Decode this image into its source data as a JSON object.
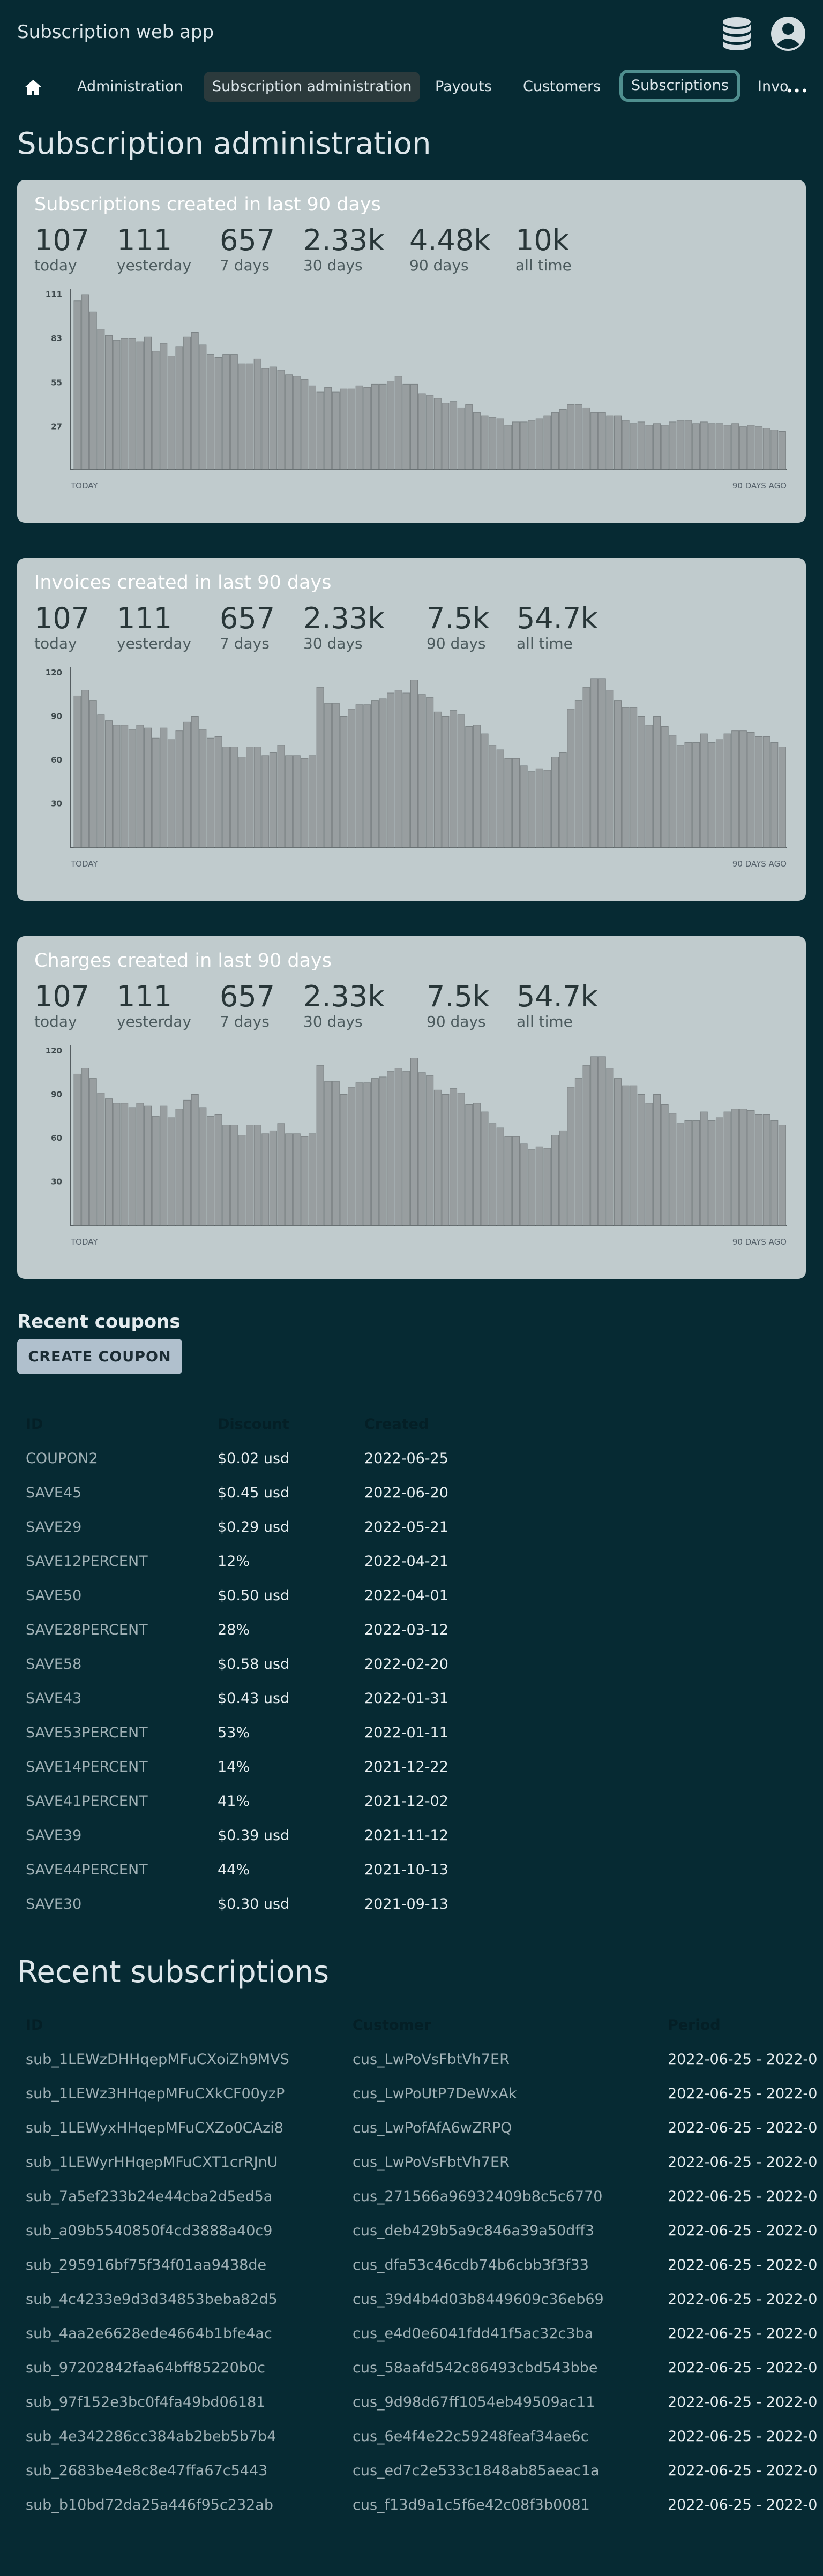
{
  "app": {
    "title": "Subscription web app",
    "icons": [
      "database-icon",
      "account-icon"
    ]
  },
  "nav": {
    "home_icon": "home-icon",
    "items": [
      {
        "label": "Administration"
      },
      {
        "label": "Subscription administration",
        "state": "selected"
      },
      {
        "label": "Payouts"
      },
      {
        "label": "Customers"
      },
      {
        "label": "Subscriptions",
        "state": "focused"
      },
      {
        "label": "Invo"
      }
    ],
    "more_label": "•••"
  },
  "page": {
    "title": "Subscription administration"
  },
  "cards": [
    {
      "title": "Subscriptions created in last 90 days",
      "stats": [
        {
          "value": "107",
          "label": "today"
        },
        {
          "value": "111",
          "label": "yesterday"
        },
        {
          "value": "657",
          "label": "7 days"
        },
        {
          "value": "2.33k",
          "label": "30 days"
        },
        {
          "value": "4.48k",
          "label": "90 days"
        },
        {
          "value": "10k",
          "label": "all time"
        }
      ]
    },
    {
      "title": "Invoices created in last 90 days",
      "stats": [
        {
          "value": "107",
          "label": "today"
        },
        {
          "value": "111",
          "label": "yesterday"
        },
        {
          "value": "657",
          "label": "7 days"
        },
        {
          "value": "2.33k",
          "label": "30 days"
        },
        {
          "value": "7.5k",
          "label": "90 days"
        },
        {
          "value": "54.7k",
          "label": "all time"
        }
      ]
    },
    {
      "title": "Charges created in last 90 days",
      "stats": [
        {
          "value": "107",
          "label": "today"
        },
        {
          "value": "111",
          "label": "yesterday"
        },
        {
          "value": "657",
          "label": "7 days"
        },
        {
          "value": "2.33k",
          "label": "30 days"
        },
        {
          "value": "7.5k",
          "label": "90 days"
        },
        {
          "value": "54.7k",
          "label": "all time"
        }
      ]
    }
  ],
  "chart_data": [
    {
      "type": "bar",
      "title": "Subscriptions created in last 90 days",
      "x_start_label": "TODAY",
      "x_end_label": "90 DAYS AGO",
      "y_ticks": [
        111,
        83,
        55,
        27
      ],
      "ylim": [
        0,
        111
      ],
      "bar_color": "#989ea0",
      "values": [
        107,
        111,
        100,
        89,
        85,
        82,
        83,
        83,
        81,
        84,
        75,
        80,
        72,
        78,
        84,
        87,
        79,
        73,
        71,
        73,
        73,
        67,
        67,
        70,
        64,
        65,
        63,
        60,
        59,
        57,
        53,
        49,
        52,
        49,
        51,
        51,
        53,
        52,
        54,
        54,
        56,
        59,
        54,
        54,
        48,
        47,
        45,
        42,
        43,
        39,
        41,
        36,
        34,
        33,
        32,
        28,
        30,
        30,
        31,
        32,
        34,
        36,
        38,
        41,
        41,
        39,
        36,
        36,
        34,
        34,
        31,
        29,
        30,
        28,
        29,
        28,
        30,
        31,
        31,
        29,
        30,
        29,
        29,
        28,
        29,
        27,
        28,
        27,
        26,
        25,
        24
      ]
    },
    {
      "type": "bar",
      "title": "Invoices created in last 90 days",
      "x_start_label": "TODAY",
      "x_end_label": "90 DAYS AGO",
      "y_ticks": [
        120,
        90,
        60,
        30
      ],
      "ylim": [
        0,
        120
      ],
      "bar_color": "#989ea0",
      "values": [
        104,
        108,
        101,
        91,
        87,
        84,
        84,
        81,
        84,
        82,
        75,
        82,
        74,
        80,
        86,
        90,
        81,
        75,
        76,
        69,
        69,
        62,
        69,
        69,
        63,
        65,
        70,
        63,
        63,
        61,
        63,
        110,
        99,
        99,
        90,
        95,
        98,
        98,
        101,
        102,
        106,
        108,
        106,
        115,
        105,
        103,
        93,
        90,
        94,
        91,
        83,
        84,
        78,
        70,
        67,
        61,
        61,
        56,
        52,
        54,
        53,
        62,
        65,
        95,
        101,
        110,
        116,
        116,
        108,
        101,
        96,
        96,
        90,
        84,
        90,
        83,
        77,
        70,
        72,
        72,
        78,
        72,
        74,
        78,
        80,
        80,
        79,
        76,
        76,
        72,
        69
      ]
    },
    {
      "type": "bar",
      "title": "Charges created in last 90 days",
      "x_start_label": "TODAY",
      "x_end_label": "90 DAYS AGO",
      "y_ticks": [
        120,
        90,
        60,
        30
      ],
      "ylim": [
        0,
        120
      ],
      "bar_color": "#989ea0",
      "values": [
        104,
        108,
        101,
        91,
        87,
        84,
        84,
        81,
        84,
        82,
        75,
        82,
        74,
        80,
        86,
        90,
        81,
        75,
        76,
        69,
        69,
        62,
        69,
        69,
        63,
        65,
        70,
        63,
        63,
        61,
        63,
        110,
        99,
        99,
        90,
        95,
        98,
        98,
        101,
        102,
        106,
        108,
        106,
        115,
        105,
        103,
        93,
        90,
        94,
        91,
        83,
        84,
        78,
        70,
        67,
        61,
        61,
        56,
        52,
        54,
        53,
        62,
        65,
        95,
        101,
        110,
        116,
        116,
        108,
        101,
        96,
        96,
        90,
        84,
        90,
        83,
        77,
        70,
        72,
        72,
        78,
        72,
        74,
        78,
        80,
        80,
        79,
        76,
        76,
        72,
        69
      ]
    }
  ],
  "coupons": {
    "heading": "Recent coupons",
    "create_label": "CREATE COUPON",
    "columns": [
      "ID",
      "Discount",
      "Created"
    ],
    "rows": [
      [
        "COUPON2",
        "$0.02 usd",
        "2022-06-25"
      ],
      [
        "SAVE45",
        "$0.45 usd",
        "2022-06-20"
      ],
      [
        "SAVE29",
        "$0.29 usd",
        "2022-05-21"
      ],
      [
        "SAVE12PERCENT",
        "12%",
        "2022-04-21"
      ],
      [
        "SAVE50",
        "$0.50 usd",
        "2022-04-01"
      ],
      [
        "SAVE28PERCENT",
        "28%",
        "2022-03-12"
      ],
      [
        "SAVE58",
        "$0.58 usd",
        "2022-02-20"
      ],
      [
        "SAVE43",
        "$0.43 usd",
        "2022-01-31"
      ],
      [
        "SAVE53PERCENT",
        "53%",
        "2022-01-11"
      ],
      [
        "SAVE14PERCENT",
        "14%",
        "2021-12-22"
      ],
      [
        "SAVE41PERCENT",
        "41%",
        "2021-12-02"
      ],
      [
        "SAVE39",
        "$0.39 usd",
        "2021-11-12"
      ],
      [
        "SAVE44PERCENT",
        "44%",
        "2021-10-13"
      ],
      [
        "SAVE30",
        "$0.30 usd",
        "2021-09-13"
      ]
    ]
  },
  "subscriptions": {
    "heading": "Recent subscriptions",
    "columns": [
      "ID",
      "Customer",
      "Period"
    ],
    "rows": [
      [
        "sub_1LEWzDHHqepMFuCXoiZh9MVS",
        "cus_LwPoVsFbtVh7ER",
        "2022-06-25 - 2022-0"
      ],
      [
        "sub_1LEWz3HHqepMFuCXkCF00yzP",
        "cus_LwPoUtP7DeWxAk",
        "2022-06-25 - 2022-0"
      ],
      [
        "sub_1LEWyxHHqepMFuCXZo0CAzi8",
        "cus_LwPofAfA6wZRPQ",
        "2022-06-25 - 2022-0"
      ],
      [
        "sub_1LEWyrHHqepMFuCXT1crRJnU",
        "cus_LwPoVsFbtVh7ER",
        "2022-06-25 - 2022-0"
      ],
      [
        "sub_7a5ef233b24e44cba2d5ed5a",
        "cus_271566a96932409b8c5c6770",
        "2022-06-25 - 2022-0"
      ],
      [
        "sub_a09b5540850f4cd3888a40c9",
        "cus_deb429b5a9c846a39a50dff3",
        "2022-06-25 - 2022-0"
      ],
      [
        "sub_295916bf75f34f01aa9438de",
        "cus_dfa53c46cdb74b6cbb3f3f33",
        "2022-06-25 - 2022-0"
      ],
      [
        "sub_4c4233e9d3d34853beba82d5",
        "cus_39d4b4d03b8449609c36eb69",
        "2022-06-25 - 2022-0"
      ],
      [
        "sub_4aa2e6628ede4664b1bfe4ac",
        "cus_e4d0e6041fdd41f5ac32c3ba",
        "2022-06-25 - 2022-0"
      ],
      [
        "sub_97202842faa64bff85220b0c",
        "cus_58aafd542c86493cbd543bbe",
        "2022-06-25 - 2022-0"
      ],
      [
        "sub_97f152e3bc0f4fa49bd06181",
        "cus_9d98d67ff1054eb49509ac11",
        "2022-06-25 - 2022-0"
      ],
      [
        "sub_4e342286cc384ab2beb5b7b4",
        "cus_6e4f4e22c59248feaf34ae6c",
        "2022-06-25 - 2022-0"
      ],
      [
        "sub_2683be4e8c8e47ffa67c5443",
        "cus_ed7c2e533c1848ab85aeac1a",
        "2022-06-25 - 2022-0"
      ],
      [
        "sub_b10bd72da25a446f95c232ab",
        "cus_f13d9a1c5f6e42c08f3b0081",
        "2022-06-25 - 2022-0"
      ]
    ]
  }
}
